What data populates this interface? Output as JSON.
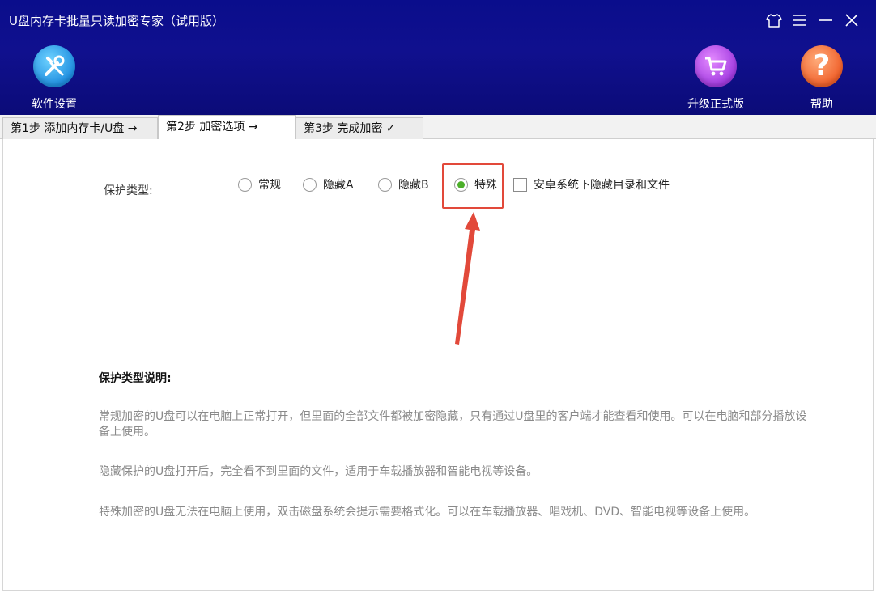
{
  "app": {
    "title": "U盘内存卡批量只读加密专家（试用版）"
  },
  "window_controls": {
    "skin": "shirt-icon",
    "menu": "menu-icon",
    "minimize": "minimize-icon",
    "close": "close-icon"
  },
  "toolbar": {
    "settings_label": "软件设置",
    "upgrade_label": "升级正式版",
    "help_label": "帮助",
    "help_glyph": "?"
  },
  "tabs": [
    {
      "label": "第1步 添加内存卡/U盘 →"
    },
    {
      "label": "第2步 加密选项 →"
    },
    {
      "label": "第3步 完成加密 ✓"
    }
  ],
  "protection": {
    "label": "保护类型:",
    "options": [
      {
        "label": "常规",
        "selected": false
      },
      {
        "label": "隐藏A",
        "selected": false
      },
      {
        "label": "隐藏B",
        "selected": false
      },
      {
        "label": "特殊",
        "selected": true
      }
    ],
    "android_hide_label": "安卓系统下隐藏目录和文件",
    "android_hide_checked": false
  },
  "description": {
    "title": "保护类型说明:",
    "paragraphs": [
      "常规加密的U盘可以在电脑上正常打开，但里面的全部文件都被加密隐藏，只有通过U盘里的客户端才能查看和使用。可以在电脑和部分播放设备上使用。",
      "隐藏保护的U盘打开后，完全看不到里面的文件，适用于车载播放器和智能电视等设备。",
      "特殊加密的U盘无法在电脑上使用，双击磁盘系统会提示需要格式化。可以在车载播放器、唱戏机、DVD、智能电视等设备上使用。"
    ]
  },
  "colors": {
    "header_bg": "#0a0d8c",
    "radio_selected": "#4caf2a",
    "annotation": "#e2493a"
  }
}
